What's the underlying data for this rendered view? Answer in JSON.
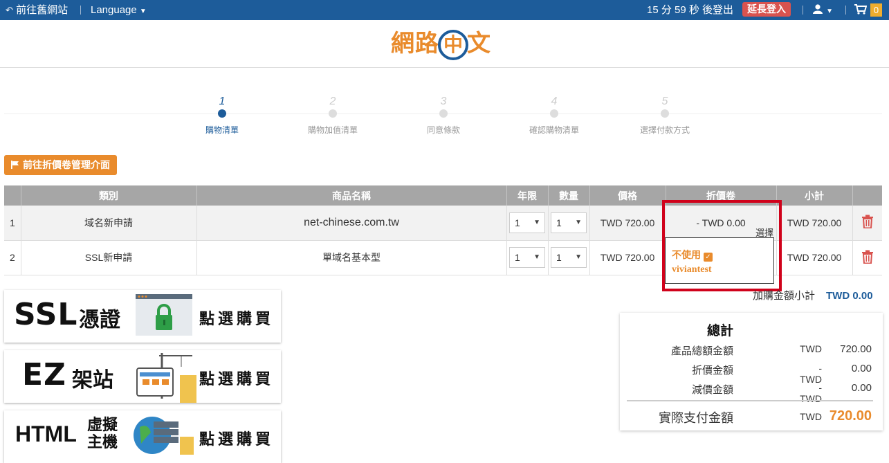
{
  "topbar": {
    "old_site": "前往舊網站",
    "language": "Language",
    "session_text": "15 分 59 秒 後登出",
    "extend_login": "延長登入",
    "cart_count": "0"
  },
  "logo": {
    "left": "網路",
    "middle": "中",
    "right": "文"
  },
  "steps": [
    {
      "num": "1",
      "label": "購物清單",
      "active": true
    },
    {
      "num": "2",
      "label": "購物加值清單",
      "active": false
    },
    {
      "num": "3",
      "label": "同意條款",
      "active": false
    },
    {
      "num": "4",
      "label": "確認購物清單",
      "active": false
    },
    {
      "num": "5",
      "label": "選擇付款方式",
      "active": false
    }
  ],
  "coupon_button": "前往折價卷管理介面",
  "table": {
    "headers": [
      "類別",
      "商品名稱",
      "年限",
      "數量",
      "價格",
      "折價卷",
      "小計"
    ],
    "rows": [
      {
        "idx": "1",
        "category": "域名新申請",
        "product": "net-chinese.com.tw",
        "years": "1",
        "qty": "1",
        "price": "TWD 720.00",
        "coupon": "- TWD 0.00",
        "subtotal": "TWD 720.00"
      },
      {
        "idx": "2",
        "category": "SSL新申請",
        "product": "單域名基本型",
        "years": "1",
        "qty": "1",
        "price": "TWD 720.00",
        "coupon": "",
        "subtotal": "TWD 720.00"
      }
    ]
  },
  "coupon_dropdown": {
    "choose_label": "選擇",
    "options": [
      "不使用",
      "viviantest"
    ]
  },
  "addon_subtotal": {
    "label": "加購金額小計",
    "value": "TWD 0.00"
  },
  "banners": [
    {
      "title": "SSL",
      "subtitle": "憑證",
      "cta": "點選購買"
    },
    {
      "title": "EZ",
      "subtitle": "架站",
      "cta": "點選購買"
    },
    {
      "title": "HTML",
      "subtitle": "虛擬主機",
      "cta": "點選購買"
    }
  ],
  "summary": {
    "title": "總計",
    "rows": [
      {
        "label": "產品總額金額",
        "currency": "TWD",
        "amount": "720.00"
      },
      {
        "label": "折價金額",
        "currency": "-TWD",
        "amount": "0.00"
      },
      {
        "label": "減價金額",
        "currency": "-TWD",
        "amount": "0.00"
      }
    ],
    "final": {
      "label": "實際支付金額",
      "currency": "TWD",
      "amount": "720.00"
    }
  },
  "colors": {
    "primary": "#1d5c9a",
    "accent": "#e98b2c",
    "danger": "#d9534f",
    "highlight": "#d0021b"
  }
}
